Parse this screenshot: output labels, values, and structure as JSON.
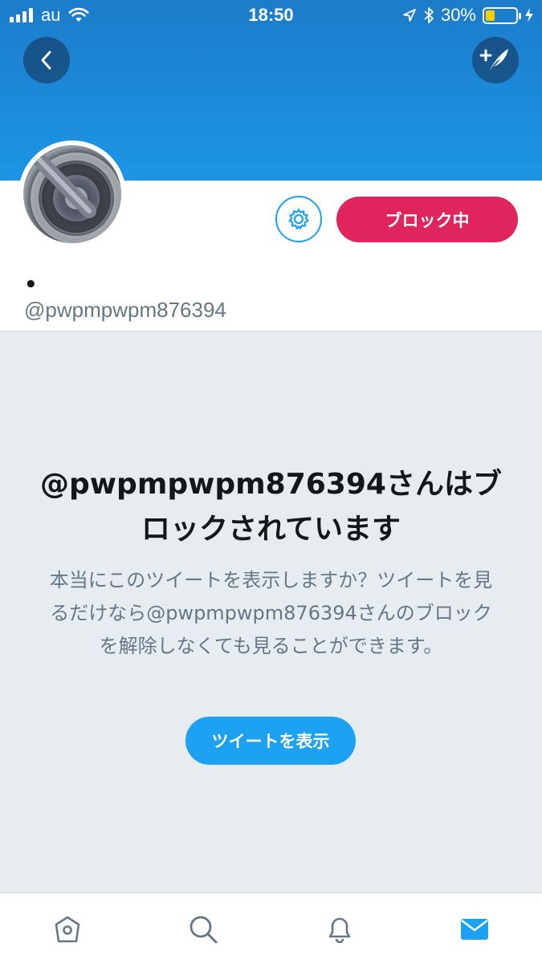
{
  "status_bar": {
    "carrier": "au",
    "time": "18:50",
    "battery_percent": "30%",
    "battery_level": 0.3,
    "icons": [
      "signal-icon",
      "wifi-icon",
      "location-icon",
      "bluetooth-icon",
      "battery-icon",
      "charging-icon"
    ]
  },
  "header": {
    "back_icon": "chevron-left-icon",
    "compose_icon": "compose-tweet-icon"
  },
  "profile": {
    "display_name": "•",
    "handle": "@pwpmpwpm876394",
    "settings_icon": "gear-icon",
    "blocked_button_label": "ブロック中"
  },
  "notice": {
    "title": "@pwpmpwpm876394さんはブロックされています",
    "body": "本当にこのツイートを表示しますか？ツイートを見るだけなら@pwpmpwpm876394さんのブロックを解除しなくても見ることができます。",
    "show_tweets_label": "ツイートを表示"
  },
  "tabs": [
    {
      "icon": "home-icon"
    },
    {
      "icon": "search-icon"
    },
    {
      "icon": "notifications-icon"
    },
    {
      "icon": "messages-icon",
      "active": true
    }
  ],
  "colors": {
    "banner_top": "#1c7cc9",
    "banner_bottom": "#1d95e6",
    "accent": "#1da1f2",
    "block_red": "#e0245e",
    "panel_bg": "#e6ecf0",
    "muted_text": "#657786",
    "tab_inactive": "#657786"
  }
}
